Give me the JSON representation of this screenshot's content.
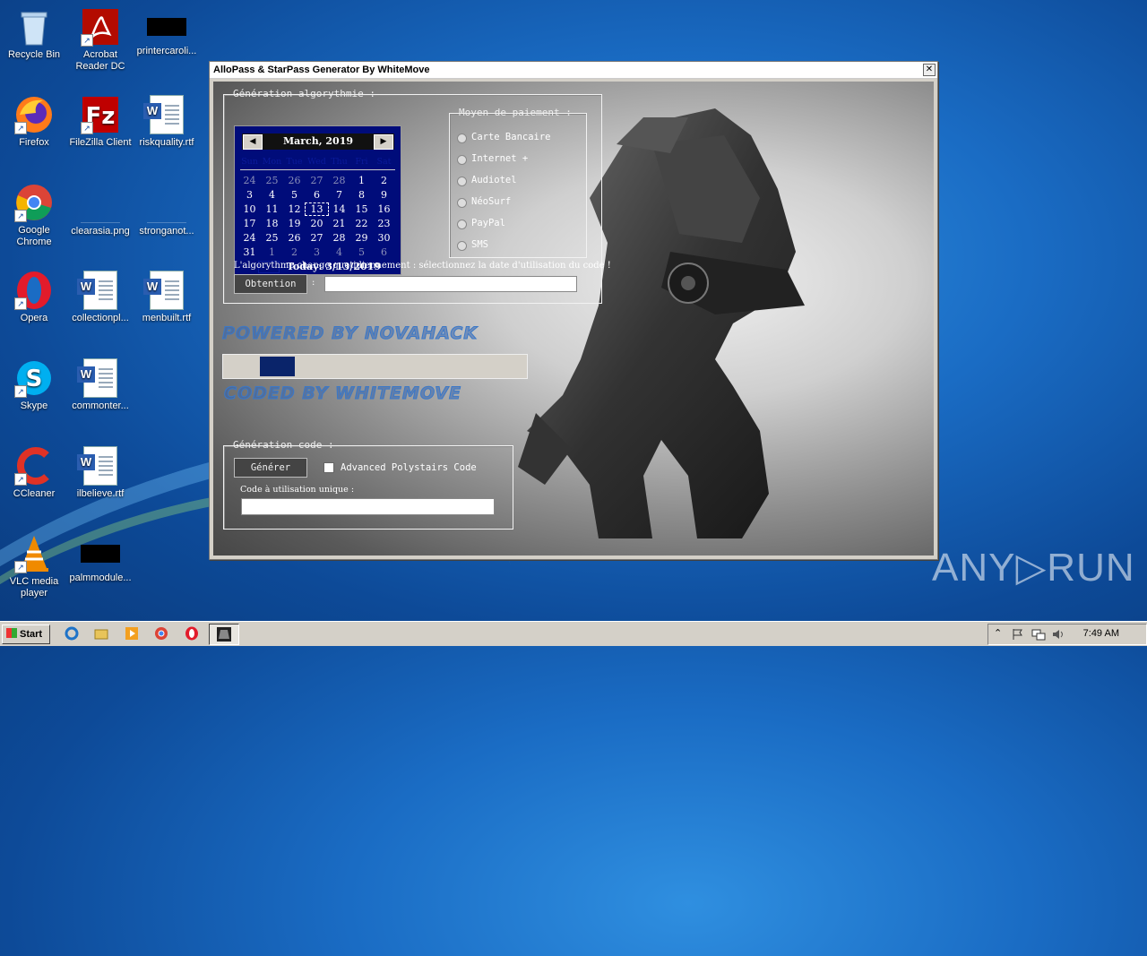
{
  "desktop": {
    "icons": [
      {
        "label": "Recycle Bin"
      },
      {
        "label": "Acrobat Reader DC"
      },
      {
        "label": "printercaroli..."
      },
      {
        "label": "Firefox"
      },
      {
        "label": "FileZilla Client"
      },
      {
        "label": "riskquality.rtf"
      },
      {
        "label": "Google Chrome"
      },
      {
        "label": "clearasia.png"
      },
      {
        "label": "stronganot..."
      },
      {
        "label": "Opera"
      },
      {
        "label": "collectionpl..."
      },
      {
        "label": "menbuilt.rtf"
      },
      {
        "label": "Skype"
      },
      {
        "label": "commonter..."
      },
      {
        "label": "CCleaner"
      },
      {
        "label": "ilbelieve.rtf"
      },
      {
        "label": "VLC media player"
      },
      {
        "label": "palmmodule..."
      }
    ]
  },
  "window": {
    "title": "AlloPass & StarPass Generator By WhiteMove",
    "close": "✕",
    "algo_group": {
      "title": "Génération algorythmie :"
    },
    "calendar": {
      "month": "March, 2019",
      "prev": "◀",
      "next": "▶",
      "weekdays": [
        "Sun",
        "Mon",
        "Tue",
        "Wed",
        "Thu",
        "Fri",
        "Sat"
      ],
      "weeks": [
        [
          "24",
          "25",
          "26",
          "27",
          "28",
          "1",
          "2"
        ],
        [
          "3",
          "4",
          "5",
          "6",
          "7",
          "8",
          "9"
        ],
        [
          "10",
          "11",
          "12",
          "13",
          "14",
          "15",
          "16"
        ],
        [
          "17",
          "18",
          "19",
          "20",
          "21",
          "22",
          "23"
        ],
        [
          "24",
          "25",
          "26",
          "27",
          "28",
          "29",
          "30"
        ],
        [
          "31",
          "1",
          "2",
          "3",
          "4",
          "5",
          "6"
        ]
      ],
      "today": "Today: 3/13/2019"
    },
    "payment": {
      "title": "Moyen de paiement :",
      "options": [
        "Carte Bancaire",
        "Internet +",
        "Audiotel",
        "NéoSurf",
        "PayPal",
        "SMS"
      ]
    },
    "note": "L'algorythme change quotidiennement : sélectionnez la date d'utilisation du code !",
    "obtain_button": "Obtention",
    "colon": ":",
    "obtain_value": "",
    "banner_powered": "POWERED BY NOVAHACK",
    "banner_coded": "CODED BY WHITEMOVE",
    "code_group": {
      "title": "Génération code :",
      "generate_button": "Générer",
      "advanced_label": "Advanced Polystairs Code",
      "unique_label": "Code à utilisation unique :",
      "unique_value": ""
    }
  },
  "taskbar": {
    "start": "Start",
    "clock": "7:49 AM"
  },
  "watermark": "ANY▷RUN"
}
